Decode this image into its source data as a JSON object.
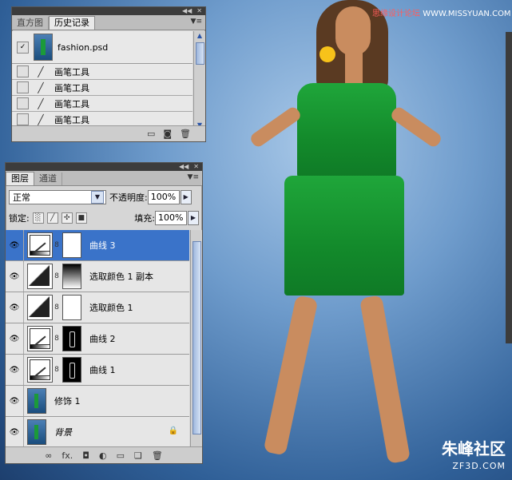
{
  "watermark": {
    "text_cn": "思缘设计论坛",
    "text_url": "WWW.MISSYUAN.COM"
  },
  "logo": {
    "text": "朱峰社区",
    "sub": "ZF3D.COM"
  },
  "history_panel": {
    "tabs": [
      "直方图",
      "历史记录"
    ],
    "snapshot": "fashion.psd",
    "items": [
      "画笔工具",
      "画笔工具",
      "画笔工具",
      "画笔工具"
    ]
  },
  "layers_panel": {
    "tabs": [
      "图层",
      "通道"
    ],
    "blend_mode": "正常",
    "opacity_label": "不透明度:",
    "opacity_value": "100%",
    "lock_label": "锁定:",
    "fill_label": "填充:",
    "fill_value": "100%",
    "layers": [
      {
        "name": "曲线 3"
      },
      {
        "name": "选取颜色 1 副本"
      },
      {
        "name": "选取颜色 1"
      },
      {
        "name": "曲线 2"
      },
      {
        "name": "曲线 1"
      },
      {
        "name": "修饰 1"
      },
      {
        "name": "背景"
      }
    ]
  },
  "icons": {
    "eye": "👁",
    "chain": "8",
    "brush": "🖌",
    "lock": "🔒",
    "fx": "fx."
  }
}
